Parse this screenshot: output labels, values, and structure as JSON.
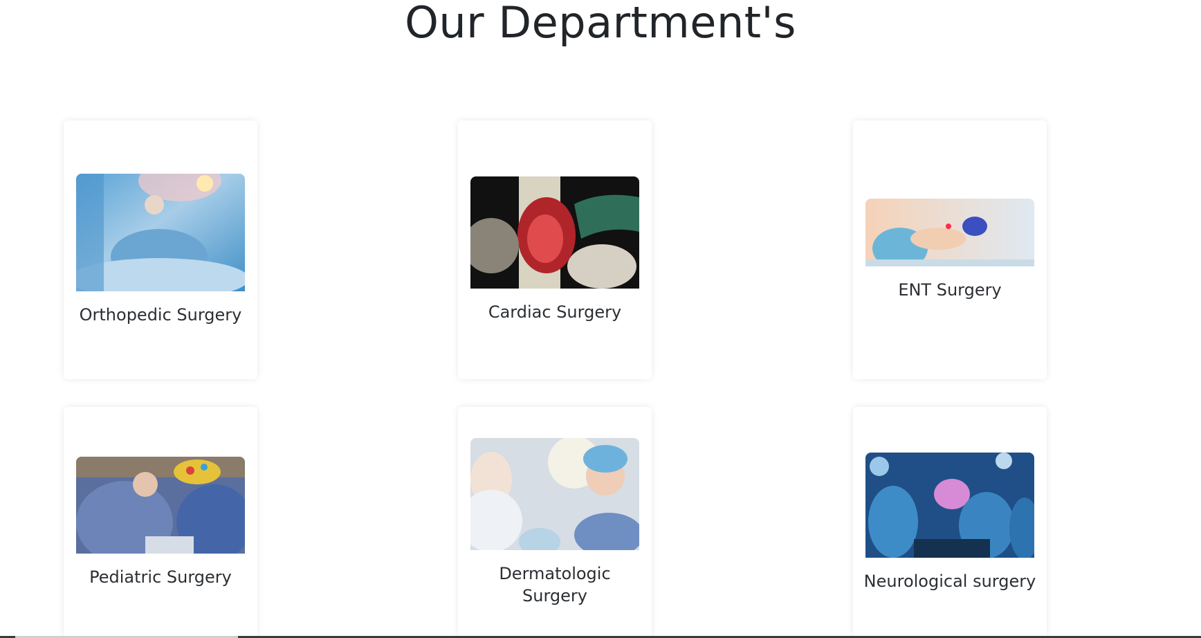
{
  "section": {
    "title": "Our Department's"
  },
  "departments": [
    {
      "name": "Orthopedic Surgery",
      "image": "orthopedic-surgery-photo"
    },
    {
      "name": "Cardiac Surgery",
      "image": "cardiac-surgery-photo"
    },
    {
      "name": "ENT Surgery",
      "image": "ent-surgery-photo"
    },
    {
      "name": "Pediatric Surgery",
      "image": "pediatric-surgery-photo"
    },
    {
      "name": "Dermatologic Surgery",
      "image": "dermatologic-surgery-photo"
    },
    {
      "name": "Neurological surgery",
      "image": "neurological-surgery-photo"
    }
  ]
}
